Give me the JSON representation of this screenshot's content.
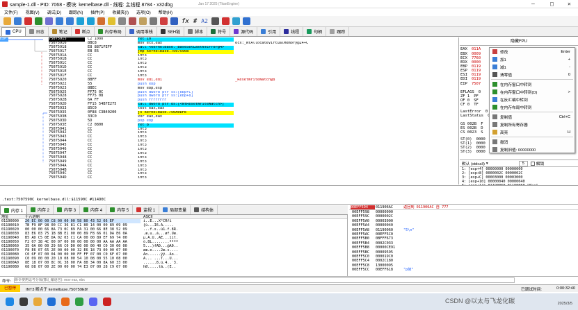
{
  "window": {
    "title": "sample-1.dll - PID: 7068 - 模块: kernelbase.dll - 线程: 主线程 8784 - x32dbg",
    "date_info": "Jan 17 2025 (TitanEngine)"
  },
  "menu": [
    "文件(F)",
    "视图(V)",
    "调试(D)",
    "跟踪(N)",
    "插件(P)",
    "收藏夹(I)",
    "选项(O)",
    "帮助(H)"
  ],
  "toolbar": {
    "fx_label": "fx",
    "hash_label": "#",
    "az_label": "A2"
  },
  "tabs": [
    {
      "label": "CPU",
      "color": "#2e6bd6"
    },
    {
      "label": "日志",
      "color": "#888888"
    },
    {
      "label": "笔记",
      "color": "#b5892f"
    },
    {
      "label": "断点",
      "color": "#d23030"
    },
    {
      "label": "内存布局",
      "color": "#2d8f2d"
    },
    {
      "label": "调用堆栈",
      "color": "#3a64c9"
    },
    {
      "label": "SEH链",
      "color": "#333333"
    },
    {
      "label": "脚本",
      "color": "#777777"
    },
    {
      "label": "符号",
      "color": "#1c6e3a"
    },
    {
      "label": "源代码",
      "color": "#6d3ad1"
    },
    {
      "label": "引用",
      "color": "#3a7ed6"
    },
    {
      "label": "线程",
      "color": "#2c2c9c"
    },
    {
      "label": "句柄",
      "color": "#189a5c"
    },
    {
      "label": "跟踪",
      "color": "#a0a0a0"
    }
  ],
  "disasm": [
    {
      "addr": "75075915",
      "bytes": "C2 1000",
      "ins": "ret 10",
      "cm": "",
      "style": "sel"
    },
    {
      "addr": "75075916",
      "bytes": "8BC8",
      "ins": "mov ecx,eax",
      "cm": "ecx:_NtAllocateVirtualMemory@24+C",
      "style": ""
    },
    {
      "addr": "75075918",
      "bytes": "E8 8871FEFF",
      "ins": "call <kernelbase._BaseSetLastNTError@4>",
      "cm": "",
      "style": "cyan"
    },
    {
      "addr": "75075917",
      "bytes": "EB E6",
      "ins": "jmp kernelbase.75075908",
      "cm": "",
      "style": "yel"
    },
    {
      "addr": "7507591A",
      "bytes": "CC",
      "ins": "int3",
      "cm": "",
      "style": ""
    },
    {
      "addr": "7507591B",
      "bytes": "CC",
      "ins": "int3",
      "cm": "",
      "style": ""
    },
    {
      "addr": "7507591C",
      "bytes": "CC",
      "ins": "int3",
      "cm": "",
      "style": ""
    },
    {
      "addr": "7507591D",
      "bytes": "CC",
      "ins": "int3",
      "cm": "",
      "style": ""
    },
    {
      "addr": "7507591E",
      "bytes": "CC",
      "ins": "int3",
      "cm": "",
      "style": ""
    },
    {
      "addr": "7507591F",
      "bytes": "CC",
      "ins": "int3",
      "cm": "",
      "style": ""
    },
    {
      "addr": "75075920",
      "bytes": "8BFF",
      "ins": "mov edi,edi",
      "cm": "_ResetWriteWatch@8",
      "style": "red"
    },
    {
      "addr": "75075922",
      "bytes": "55",
      "ins": "push ebp",
      "cm": "",
      "style": ""
    },
    {
      "addr": "75075923",
      "bytes": "8BEC",
      "ins": "mov ebp,esp",
      "cm": "",
      "style": ""
    },
    {
      "addr": "75075925",
      "bytes": "FF75 0C",
      "ins": "push dword ptr ss:[ebp+C]",
      "cm": "",
      "style": ""
    },
    {
      "addr": "75075928",
      "bytes": "FF75 08",
      "ins": "push dword ptr ss:[ebp+8]",
      "cm": "",
      "style": ""
    },
    {
      "addr": "7507592B",
      "bytes": "6A FF",
      "ins": "push FFFFFFFF",
      "cm": "",
      "style": ""
    },
    {
      "addr": "7507592D",
      "bytes": "FF15 54B7E275",
      "ins": "call dword ptr ds:[<NtResetWriteWatch>]",
      "cm": "",
      "style": "cyan2"
    },
    {
      "addr": "75075933",
      "bytes": "85C0",
      "ins": "test eax,eax",
      "cm": "",
      "style": ""
    },
    {
      "addr": "75075935",
      "bytes": "0F88 C3B40200",
      "ins": "js kernelbase.750A0DFE",
      "cm": "",
      "style": "yel"
    },
    {
      "addr": "7507593B",
      "bytes": "33C0",
      "ins": "xor eax,eax",
      "cm": "",
      "style": ""
    },
    {
      "addr": "7507593D",
      "bytes": "5D",
      "ins": "pop ebp",
      "cm": "",
      "style": ""
    },
    {
      "addr": "7507593E",
      "bytes": "C2 0800",
      "ins": "ret 8",
      "cm": "",
      "style": ""
    },
    {
      "addr": "75075941",
      "bytes": "CC",
      "ins": "int3",
      "cm": "",
      "style": ""
    },
    {
      "addr": "75075942",
      "bytes": "CC",
      "ins": "int3",
      "cm": "",
      "style": ""
    },
    {
      "addr": "75075943",
      "bytes": "CC",
      "ins": "int3",
      "cm": "",
      "style": ""
    },
    {
      "addr": "75075944",
      "bytes": "CC",
      "ins": "int3",
      "cm": "",
      "style": ""
    },
    {
      "addr": "75075945",
      "bytes": "CC",
      "ins": "int3",
      "cm": "",
      "style": ""
    },
    {
      "addr": "75075946",
      "bytes": "CC",
      "ins": "int3",
      "cm": "",
      "style": ""
    },
    {
      "addr": "75075947",
      "bytes": "CC",
      "ins": "int3",
      "cm": "",
      "style": ""
    },
    {
      "addr": "75075948",
      "bytes": "CC",
      "ins": "int3",
      "cm": "",
      "style": ""
    },
    {
      "addr": "75075949",
      "bytes": "CC",
      "ins": "int3",
      "cm": "",
      "style": ""
    },
    {
      "addr": "7507594A",
      "bytes": "CC",
      "ins": "int3",
      "cm": "",
      "style": ""
    },
    {
      "addr": "7507594B",
      "bytes": "CC",
      "ins": "int3",
      "cm": "",
      "style": ""
    },
    {
      "addr": "7507594C",
      "bytes": "CC",
      "ins": "int3",
      "cm": "",
      "style": ""
    },
    {
      "addr": "7507594D",
      "bytes": "CC",
      "ins": "int3",
      "cm": "",
      "style": ""
    }
  ],
  "registers": {
    "header": "隐藏FPU",
    "regs": [
      {
        "name": "EAX",
        "val": "011A"
      },
      {
        "name": "EBX",
        "val": "0009"
      },
      {
        "name": "ECX",
        "val": "7760"
      },
      {
        "name": "EDX",
        "val": "0000"
      },
      {
        "name": "EBP",
        "val": "0119"
      },
      {
        "name": "ESP",
        "val": "0119"
      },
      {
        "name": "ESI",
        "val": "0119"
      },
      {
        "name": "EDI",
        "val": "0119"
      },
      {
        "name": "EIP",
        "val": "7507"
      },
      {
        "name": "EFLAGS",
        "val": "0"
      },
      {
        "name": "ZF 1",
        "val": "PF"
      },
      {
        "name": "OF 0",
        "val": "SF"
      },
      {
        "name": "CF 0",
        "val": "TF"
      },
      {
        "name": "LastError",
        "val": "0"
      },
      {
        "name": "LastStatus",
        "val": "C"
      },
      {
        "name": "GS 002B",
        "val": "F"
      },
      {
        "name": "ES 002B",
        "val": "D"
      },
      {
        "name": "CS 0023",
        "val": "S"
      },
      {
        "name": "ST(0)",
        "val": "0000"
      },
      {
        "name": "ST(1)",
        "val": "0000"
      },
      {
        "name": "ST(2)",
        "val": "0000"
      },
      {
        "name": "ST(3)",
        "val": "0000"
      }
    ]
  },
  "context_menu": [
    {
      "label": "修改",
      "shortcut": "Enter",
      "icon": "#c84040"
    },
    {
      "label": "加1",
      "shortcut": "+",
      "icon": "#3a7ed6"
    },
    {
      "label": "减1",
      "shortcut": "-",
      "icon": "#3a7ed6"
    },
    {
      "label": "清零值",
      "shortcut": "0",
      "icon": "#555555"
    },
    {
      "label": "在内存窗口中转到",
      "shortcut": "",
      "icon": "#2d8f2d"
    },
    {
      "label": "在内存窗口中转到(D)",
      "shortcut": ">",
      "icon": "#2d8f2d"
    },
    {
      "label": "在反汇编中转到",
      "shortcut": "",
      "icon": "#3a7ed6"
    },
    {
      "label": "在内存布局中转到",
      "shortcut": "",
      "icon": "#2d8f2d"
    },
    {
      "label": "复制值",
      "shortcut": "Ctrl+C",
      "icon": "#777777"
    },
    {
      "label": "复制所有寄存器",
      "shortcut": "",
      "icon": "#777777"
    },
    {
      "label": "高亮",
      "shortcut": "H",
      "icon": "#d2a030"
    },
    {
      "label": "撤消",
      "shortcut": "",
      "icon": "#777777"
    },
    {
      "label": "复制旧值: 00000000",
      "shortcut": "",
      "icon": "#777777"
    }
  ],
  "callconv": {
    "label": "默认 (stdcall)",
    "num": "5",
    "unlocked": "解锁"
  },
  "stack_args": [
    "1: [esp+4] 00000000 00000000",
    "2: [esp+8] 0000002C 0000002C",
    "3: [esp+C] 00003000 00003000",
    "4: [esp+10] 00000040 00000040",
    "5: [esp+14] 01190060 01190060 \"5\\n\""
  ],
  "info_line": ".text:7507590C kernelbase.dll:$11590C #114D0C",
  "dump_tabs": [
    "内存 1",
    "内存 2",
    "内存 3",
    "内存 4",
    "内存 5",
    "监视 1",
    "局部变量",
    "结构体"
  ],
  "dump_headers": {
    "addr": "地址",
    "hex": "十六进制",
    "ascii": "ASCII"
  },
  "dump": [
    {
      "a": "01190000",
      "h": "20 EC 00 00 C8 00 00 00 58 B0 43 52 66 EF",
      "s": "ì..È...X°CRfï"
    },
    {
      "a": "01190010",
      "h": "7B F9 8F 98 00 CC 36 81 C1 80 14 00 00 89 09 09",
      "s": "{ù...Ì6.Á.....  "
    },
    {
      "a": "01190020",
      "h": "00 00 00 66 8A 73 0C 89 FA 31 00 66 8E 38 52 09",
      "s": "...f.s..ú1.f.8R."
    },
    {
      "a": "01190030",
      "h": "83 E6 03 75 1B 8B E1 00 00 89 F8 66 01 DA E6 0A",
      "s": ".æ.u..á...øf.Úæ."
    },
    {
      "a": "01190040",
      "h": "B5 AD C5 0E DA 02 03 C1 CA 00 00 89 EF 69 74 00",
      "s": "µ.Å.Ú..ÁÊ...ïit."
    },
    {
      "a": "01190050",
      "h": "F2 07 38 4C 00 07 00 00 00 00 00 00 AA AA AA AA",
      "s": "ò.8L........ªªªª"
    },
    {
      "a": "01190060",
      "h": "35 0A 00 00 29 66 C0 D0 00 00 00 40 C0 30 00 00",
      "s": "5...)fÀÐ...@À0.."
    },
    {
      "a": "01190070",
      "h": "F8 E6 07 65 2E 00 00 00 32 E6 18 73 00 00 07 00",
      "s": "øæ.e....2æ.s...."
    },
    {
      "a": "01190080",
      "h": "C0 6F 07 00 04 00 00 00 FF FF 07 00 C0 6F 07 00",
      "s": "Ào......ÿÿ..Ào.."
    },
    {
      "a": "01190090",
      "h": "C0 09 00 00 20 10 08 00 54 10 08 00 55 10 08 00",
      "s": "À... ...T...U..."
    },
    {
      "a": "011900A0",
      "h": "8E 18 07 00 8C 01 38 00 FA 88 34 00 8A 60 33 00",
      "s": "......8.ú.4..`3."
    },
    {
      "a": "011900B0",
      "h": "68 D8 07 00 2E 00 00 00 74 E3 07 00 28 C9 07 00",
      "s": "hØ.....tã..(É.."
    }
  ],
  "stack_header": {
    "esp": "00EFF594",
    "val": "011906AC",
    "cm": "返回到 011906AC 自 777"
  },
  "stack": [
    {
      "a": "00EFF594",
      "v": "011906AC",
      "c": "返回到 011906AC 自 777",
      "sel": true
    },
    {
      "a": "00EFF598",
      "v": "00000000",
      "c": ""
    },
    {
      "a": "00EFF59C",
      "v": "0000002C",
      "c": ""
    },
    {
      "a": "00EFF5A0",
      "v": "00003000",
      "c": ""
    },
    {
      "a": "00EFF5A4",
      "v": "00000040",
      "c": ""
    },
    {
      "a": "00EFF5A8",
      "v": "01190060",
      "c": "\"5\\n\""
    },
    {
      "a": "00EFF5AC",
      "v": "00EFF5C0",
      "c": ""
    },
    {
      "a": "00EFF5B0",
      "v": "0BFFF673",
      "c": ""
    },
    {
      "a": "00EFF5B4",
      "v": "0002C033",
      "c": ""
    },
    {
      "a": "00EFF5B8",
      "v": "00000CE91",
      "c": ""
    },
    {
      "a": "00EFF5BC",
      "v": "00009595",
      "c": ""
    },
    {
      "a": "00EFF5C0",
      "v": "000019C0",
      "c": ""
    },
    {
      "a": "00EFF5C4",
      "v": "0002C180",
      "c": ""
    },
    {
      "a": "00EFF5C8",
      "v": "13000095",
      "c": ""
    },
    {
      "a": "00EFF5CC",
      "v": "00EFF618",
      "c": "\"p帧\""
    }
  ],
  "cmd": {
    "label": "命令:",
    "placeholder": "命令使用逗号分隔(像汇编语言): mov eax, ebx"
  },
  "status": {
    "state": "已暂停",
    "msg": "INT3 断点于 kernelbase.750759E8!",
    "right_label": "已调试时间:",
    "time": "0:00:32:40"
  },
  "taskbar": {
    "watermark": "CSDN @以太与飞龙化碳",
    "clock": "2025/3/5"
  },
  "colors": {
    "accent": "#4aa3ff",
    "paused": "#ffcc00",
    "cyan": "#00e1ff",
    "yellow": "#ffff00"
  }
}
